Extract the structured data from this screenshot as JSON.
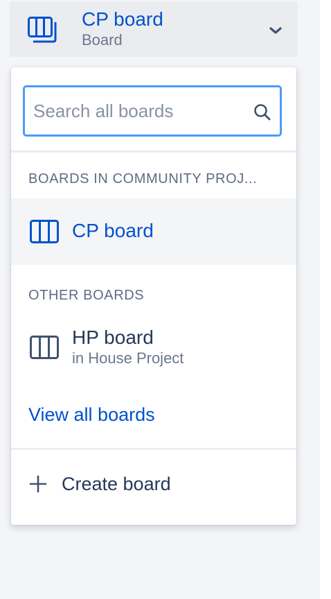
{
  "header": {
    "title": "CP board",
    "subtitle": "Board"
  },
  "search": {
    "placeholder": "Search all boards",
    "value": ""
  },
  "sections": [
    {
      "heading": "BOARDS IN COMMUNITY PROJ...",
      "boards": [
        {
          "name": "CP board",
          "project": "",
          "selected": true
        }
      ]
    },
    {
      "heading": "OTHER BOARDS",
      "boards": [
        {
          "name": "HP board",
          "project": "in House Project",
          "selected": false
        }
      ]
    }
  ],
  "links": {
    "view_all": "View all boards",
    "create": "Create board"
  },
  "colors": {
    "accent": "#0052cc",
    "focus_border": "#4c9aff",
    "text_dark": "#172b4d",
    "text_subtle": "#6b778c",
    "selected_bg": "#f4f5f7"
  },
  "icons": {
    "header_board": "board-columns-icon",
    "chevron": "chevron-down-icon",
    "search": "search-icon",
    "row_board": "board-columns-icon",
    "create": "plus-icon"
  }
}
